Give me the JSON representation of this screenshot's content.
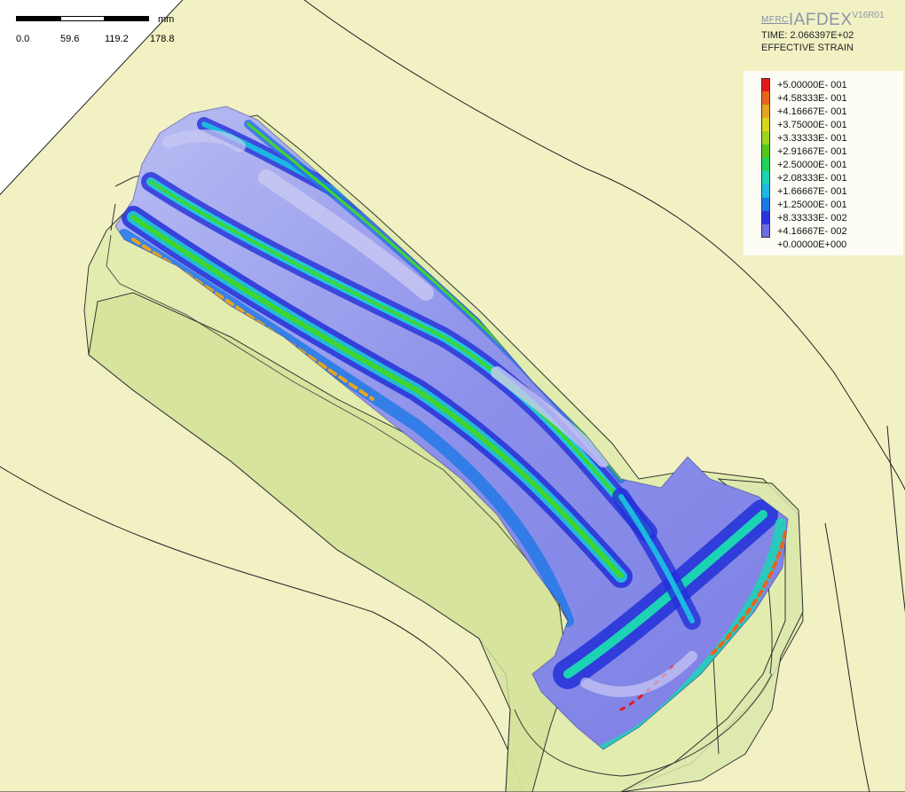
{
  "app": {
    "company": "MFRC",
    "product": "IAFDEX",
    "version": "V16R01"
  },
  "scale_bar": {
    "unit": "mm",
    "ticks": [
      "0.0",
      "59.6",
      "119.2",
      "178.8"
    ]
  },
  "simulation": {
    "time_label": "TIME: 2.066397E+02",
    "variable": "EFFECTIVE STRAIN"
  },
  "legend": {
    "entries": [
      {
        "label": "+5.00000E- 001",
        "color": "#e21a1a"
      },
      {
        "label": "+4.58333E- 001",
        "color": "#e8651c"
      },
      {
        "label": "+4.16667E- 001",
        "color": "#e6a51f"
      },
      {
        "label": "+3.75000E- 001",
        "color": "#d6d61c"
      },
      {
        "label": "+3.33333E- 001",
        "color": "#9cd41e"
      },
      {
        "label": "+2.91667E- 001",
        "color": "#52c81e"
      },
      {
        "label": "+2.50000E- 001",
        "color": "#1ed25c"
      },
      {
        "label": "+2.08333E- 001",
        "color": "#1cd3b4"
      },
      {
        "label": "+1.66667E- 001",
        "color": "#1cb8e2"
      },
      {
        "label": "+1.25000E- 001",
        "color": "#1c78e6"
      },
      {
        "label": "+8.33333E- 002",
        "color": "#2c34dd"
      },
      {
        "label": "+4.16667E- 002",
        "color": "#6e6ee0"
      },
      {
        "label": "+0.00000E+000",
        "color": "#c9c9f3"
      }
    ]
  },
  "colors": {
    "die": "#f2f1c4",
    "cavity": "#dde9a8",
    "part_base": "#6e72e0"
  }
}
